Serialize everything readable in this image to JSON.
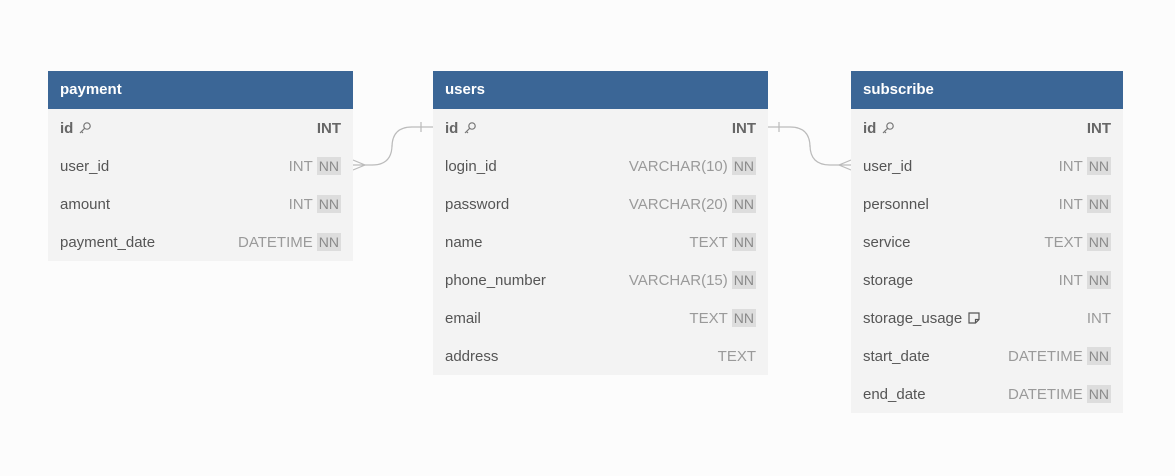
{
  "tables": {
    "payment": {
      "title": "payment",
      "rows": [
        {
          "name": "id",
          "type": "INT",
          "pk": true,
          "nn": ""
        },
        {
          "name": "user_id",
          "type": "INT",
          "nn": "NN"
        },
        {
          "name": "amount",
          "type": "INT",
          "nn": "NN"
        },
        {
          "name": "payment_date",
          "type": "DATETIME",
          "nn": "NN"
        }
      ]
    },
    "users": {
      "title": "users",
      "rows": [
        {
          "name": "id",
          "type": "INT",
          "pk": true,
          "nn": ""
        },
        {
          "name": "login_id",
          "type": "VARCHAR(10)",
          "nn": "NN"
        },
        {
          "name": "password",
          "type": "VARCHAR(20)",
          "nn": "NN"
        },
        {
          "name": "name",
          "type": "TEXT",
          "nn": "NN"
        },
        {
          "name": "phone_number",
          "type": "VARCHAR(15)",
          "nn": "NN"
        },
        {
          "name": "email",
          "type": "TEXT",
          "nn": "NN"
        },
        {
          "name": "address",
          "type": "TEXT",
          "nn": ""
        }
      ]
    },
    "subscribe": {
      "title": "subscribe",
      "rows": [
        {
          "name": "id",
          "type": "INT",
          "pk": true,
          "nn": ""
        },
        {
          "name": "user_id",
          "type": "INT",
          "nn": "NN"
        },
        {
          "name": "personnel",
          "type": "INT",
          "nn": "NN"
        },
        {
          "name": "service",
          "type": "TEXT",
          "nn": "NN"
        },
        {
          "name": "storage",
          "type": "INT",
          "nn": "NN"
        },
        {
          "name": "storage_usage",
          "type": "INT",
          "nn": "",
          "note": true
        },
        {
          "name": "start_date",
          "type": "DATETIME",
          "nn": "NN"
        },
        {
          "name": "end_date",
          "type": "DATETIME",
          "nn": "NN"
        }
      ]
    }
  },
  "colors": {
    "header": "#3b6696",
    "body": "#f3f3f3",
    "connector": "#bbbbbb"
  },
  "icons": {
    "primary_key": "key-icon",
    "note": "note-icon"
  }
}
